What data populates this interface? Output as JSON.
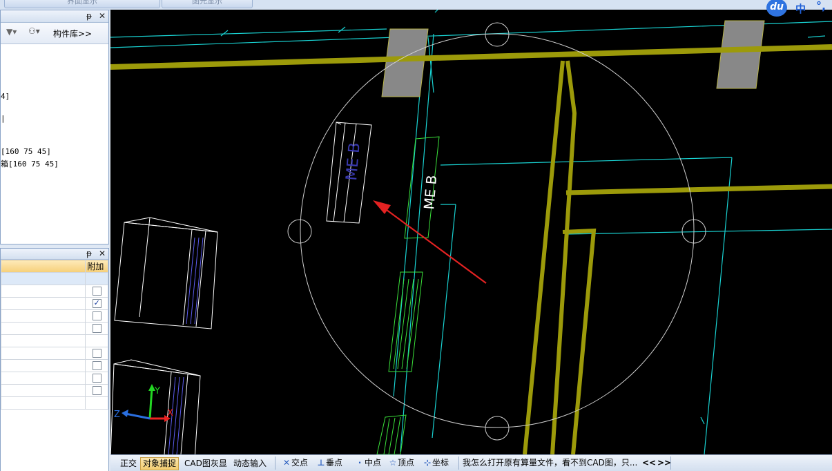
{
  "top_tabs": [
    "界面显示",
    "图元显示"
  ],
  "component_panel": {
    "library_label": "构件库>>",
    "tree_lines": [
      "4]",
      "[160 75 45]",
      "箱[160 75 45]"
    ]
  },
  "attribute_panel": {
    "column_extra": "附加",
    "rows": [
      {
        "checkbox": false,
        "checked": false
      },
      {
        "checkbox": true,
        "checked": false
      },
      {
        "checkbox": true,
        "checked": true
      },
      {
        "checkbox": true,
        "checked": false
      },
      {
        "checkbox": true,
        "checked": false
      },
      {
        "checkbox": false,
        "checked": false
      },
      {
        "checkbox": true,
        "checked": false
      },
      {
        "checkbox": true,
        "checked": false
      },
      {
        "checkbox": true,
        "checked": false
      },
      {
        "checkbox": true,
        "checked": false
      },
      {
        "checkbox": false,
        "checked": false
      }
    ]
  },
  "canvas": {
    "labels": [
      "ME B",
      "ME B"
    ],
    "axis_x": "X",
    "axis_y": "Y",
    "axis_z": "Z"
  },
  "statusbar": {
    "modes": [
      {
        "label": "正交",
        "active": false
      },
      {
        "label": "对象捕捉",
        "active": true
      },
      {
        "label": "CAD图灰显",
        "active": false
      },
      {
        "label": "动态输入",
        "active": false
      }
    ],
    "snaps": [
      "交点",
      "垂点",
      "中点",
      "顶点",
      "坐标"
    ],
    "message": "我怎么打开原有算量文件，看不到CAD图，只...",
    "nav_prev": "<<",
    "nav_next": ">>"
  },
  "ime": {
    "logo": "du",
    "lang": "中",
    "punct": "°,"
  },
  "colors": {
    "canvas_bg": "#000000",
    "wall": "#9c9a0a",
    "cyan": "#19d2d2",
    "green": "#3be33b"
  }
}
